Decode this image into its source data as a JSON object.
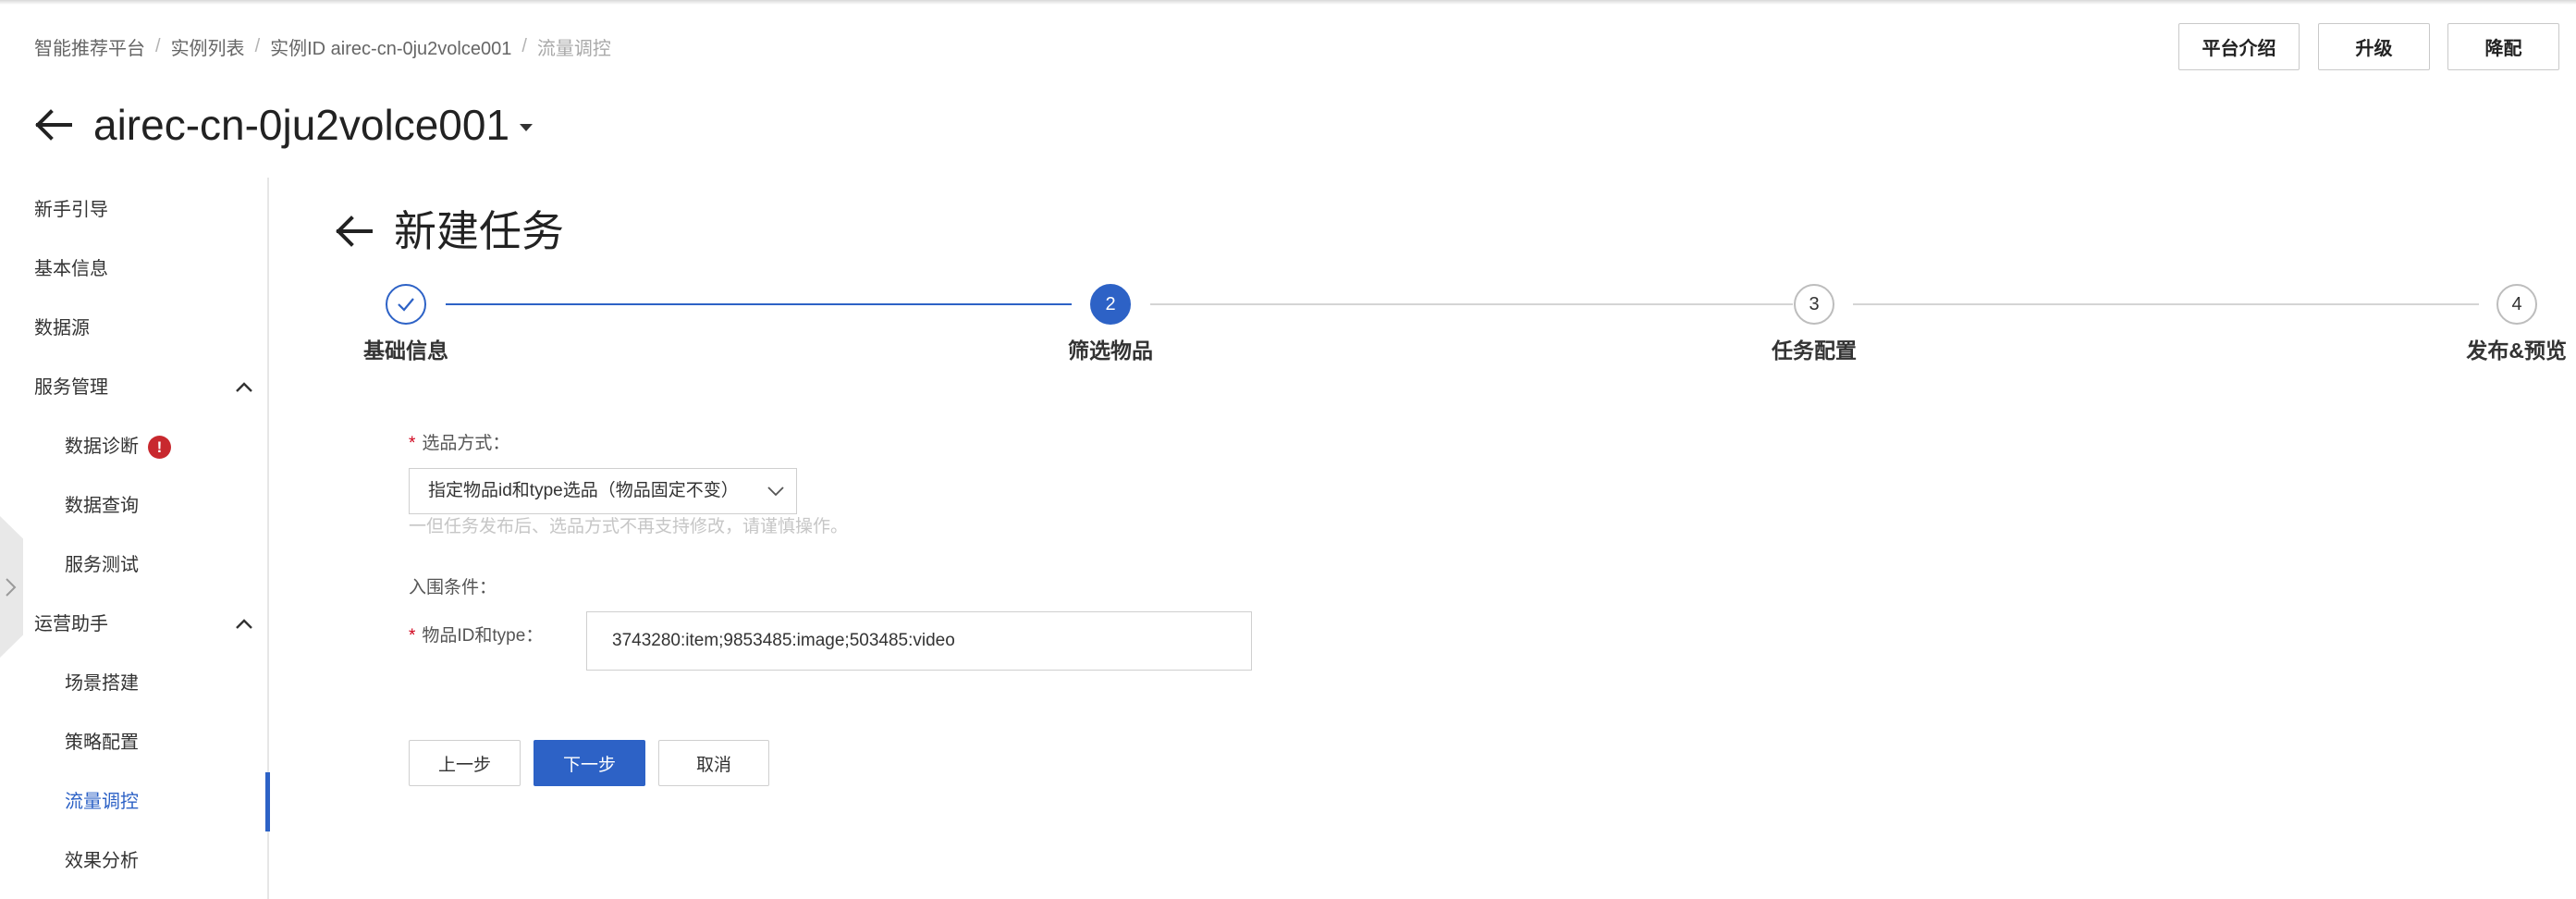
{
  "colors": {
    "accent": "#2d62c6",
    "danger": "#c8282e",
    "border": "#cfcfcf",
    "muted": "#c6c6c6"
  },
  "icons": {
    "back": "arrow-left-icon",
    "title_dropdown": "caret-down-icon",
    "group_toggle": "chevron-up-icon",
    "sidebar_collapse": "chevron-right-icon",
    "step_done": "check-icon",
    "select_dropdown": "chevron-down-icon"
  },
  "breadcrumb": {
    "separator": "/",
    "items": [
      "智能推荐平台",
      "实例列表",
      "实例ID airec-cn-0ju2volce001",
      "流量调控"
    ]
  },
  "header_actions": {
    "intro": "平台介绍",
    "upgrade": "升级",
    "downgrade": "降配"
  },
  "instance": {
    "title": "airec-cn-0ju2volce001"
  },
  "sidebar": {
    "items": [
      {
        "label": "新手引导"
      },
      {
        "label": "基本信息"
      },
      {
        "label": "数据源"
      },
      {
        "label": "服务管理",
        "expanded": true
      },
      {
        "label": "数据诊断",
        "badge": "!"
      },
      {
        "label": "数据查询"
      },
      {
        "label": "服务测试"
      },
      {
        "label": "运营助手",
        "expanded": true
      },
      {
        "label": "场景搭建"
      },
      {
        "label": "策略配置"
      },
      {
        "label": "流量调控",
        "active": true
      },
      {
        "label": "效果分析"
      }
    ]
  },
  "page": {
    "title": "新建任务"
  },
  "steps": [
    {
      "label": "基础信息",
      "done": true
    },
    {
      "number": "2",
      "label": "筛选物品",
      "current": true
    },
    {
      "number": "3",
      "label": "任务配置"
    },
    {
      "number": "4",
      "label": "发布&预览"
    }
  ],
  "form": {
    "select_mode": {
      "required_mark": "*",
      "label": "选品方式：",
      "value": "指定物品id和type选品（物品固定不变）",
      "help": "一但任务发布后、选品方式不再支持修改，请谨慎操作。"
    },
    "criteria_heading": "入围条件：",
    "item_ids": {
      "required_mark": "*",
      "label": "物品ID和type：",
      "value": "3743280:item;9853485:image;503485:video"
    }
  },
  "actions": {
    "prev": "上一步",
    "next": "下一步",
    "cancel": "取消"
  }
}
